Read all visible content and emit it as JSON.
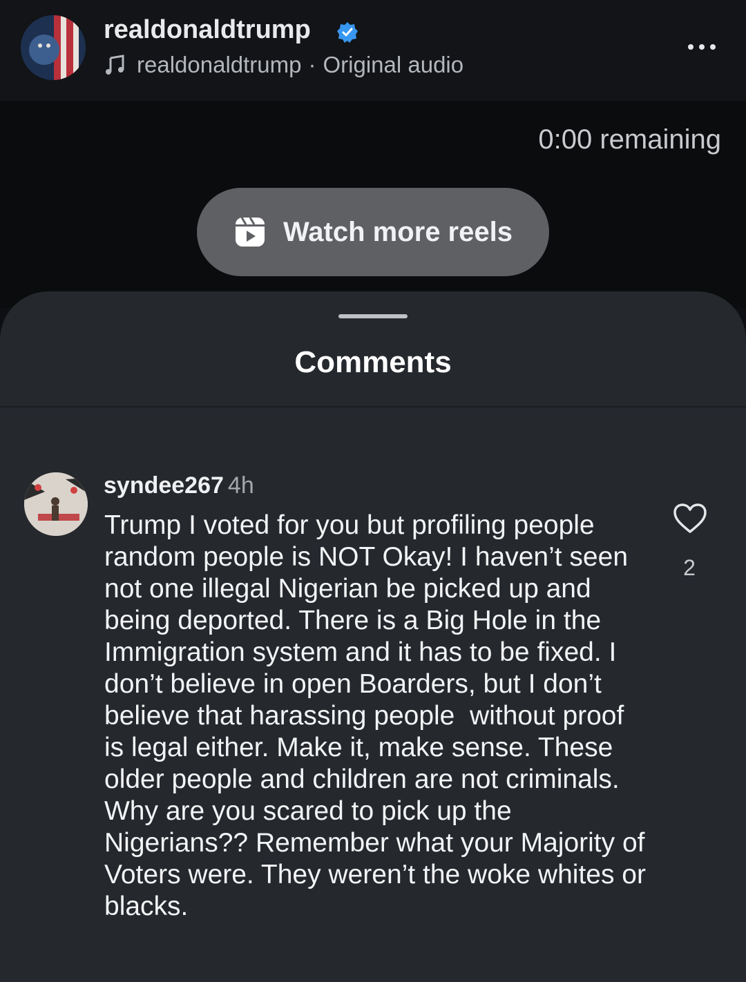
{
  "header": {
    "username": "realdonaldtrump",
    "audio_owner": "realdonaldtrump",
    "audio_separator": "·",
    "audio_label": "Original audio",
    "verified_icon": "verified-badge-icon",
    "more_icon": "more-options-icon"
  },
  "player": {
    "remaining": "0:00 remaining",
    "watch_more_label": "Watch more reels",
    "watch_more_icon": "reels-icon"
  },
  "comments_sheet": {
    "title": "Comments",
    "comments": [
      {
        "username": "syndee267",
        "time": "4h",
        "text": "Trump I voted for you but profiling people random people is NOT Okay! I haven’t seen not one illegal Nigerian be picked up and being deported. There is a Big Hole in the Immigration system and it has to be fixed. I don’t believe in open Boarders, but I don’t believe that harassing people  without proof is legal either. Make it, make sense. These older people and children are not criminals. Why are you scared to pick up the Nigerians?? Remember what your Majority of Voters were. They weren’t the woke whites or blacks.",
        "likes": "2",
        "like_icon": "heart-icon"
      }
    ]
  },
  "colors": {
    "background": "#0d0f12",
    "sheet": "#25282d",
    "button": "#5e6064",
    "verified": "#3897f0"
  }
}
